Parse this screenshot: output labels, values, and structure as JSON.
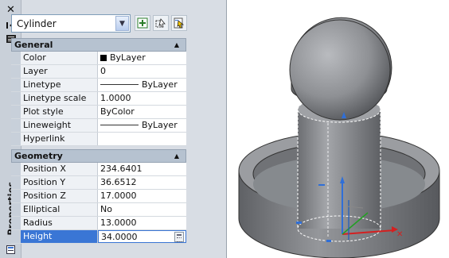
{
  "palette": {
    "title": "Properties",
    "close_glyph": "✕",
    "object_type": "Cylinder",
    "toolbar_icons": [
      "toggle-pickadd-icon",
      "select-objects-icon",
      "quick-select-icon"
    ],
    "side_icons": [
      "close-icon",
      "auto-hide-icon",
      "properties-menu-icon",
      "properties-footer-icon"
    ]
  },
  "general": {
    "header": "General",
    "rows": [
      {
        "name": "Color",
        "value": "ByLayer",
        "swatch": "#000000"
      },
      {
        "name": "Layer",
        "value": "0"
      },
      {
        "name": "Linetype",
        "value": "ByLayer"
      },
      {
        "name": "Linetype scale",
        "value": "1.0000"
      },
      {
        "name": "Plot style",
        "value": "ByColor"
      },
      {
        "name": "Lineweight",
        "value": "ByLayer"
      },
      {
        "name": "Hyperlink",
        "value": ""
      }
    ]
  },
  "geometry": {
    "header": "Geometry",
    "rows": [
      {
        "name": "Position X",
        "value": "234.6401"
      },
      {
        "name": "Position Y",
        "value": "36.6512"
      },
      {
        "name": "Position Z",
        "value": "17.0000"
      },
      {
        "name": "Elliptical",
        "value": "No"
      },
      {
        "name": "Radius",
        "value": "13.0000"
      },
      {
        "name": "Height",
        "value": "34.0000"
      }
    ]
  },
  "colors": {
    "selected_row": "#3a76d5",
    "category_header": "#b6c2d0",
    "model_surface": "#8d8f93"
  }
}
